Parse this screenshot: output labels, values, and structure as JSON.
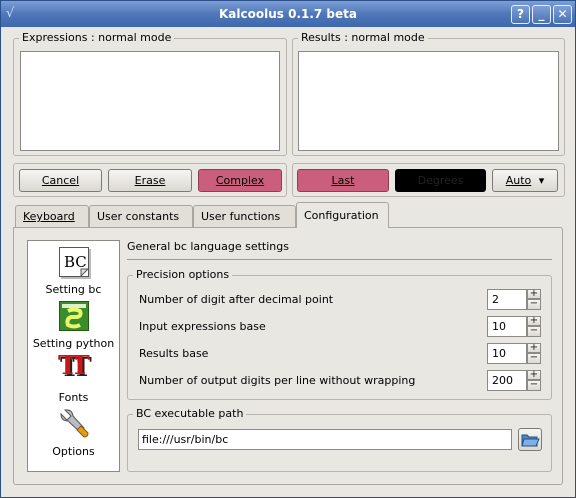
{
  "window": {
    "title": "Kalcoolus 0.1.7 beta",
    "app_icon_glyph": "√",
    "help_glyph": "?",
    "minimize_glyph": "_",
    "close_glyph": "✕"
  },
  "expressions": {
    "title": "Expressions : normal mode"
  },
  "results": {
    "title": "Results : normal mode"
  },
  "left_buttons": {
    "cancel": "Cancel",
    "erase": "Erase",
    "complex": "Complex"
  },
  "right_buttons": {
    "last": "Last",
    "dark_button": "Degrees",
    "auto": "Auto",
    "auto_arrow": "▾"
  },
  "tabs": [
    {
      "label": "Keyboard"
    },
    {
      "label": "User constants"
    },
    {
      "label": "User functions"
    },
    {
      "label": "Configuration"
    }
  ],
  "sidebar": {
    "items": [
      {
        "label": "Setting bc",
        "icon_text": "BC"
      },
      {
        "label": "Setting python"
      },
      {
        "label": "Fonts",
        "icon_text": "TT"
      },
      {
        "label": "Options"
      }
    ]
  },
  "config": {
    "heading": "General bc language settings",
    "precision_title": "Precision options",
    "rows": [
      {
        "label": "Number of digit after decimal point",
        "value": "2"
      },
      {
        "label": "Input expressions base",
        "value": "10"
      },
      {
        "label": "Results base",
        "value": "10"
      },
      {
        "label": "Number of output digits per line without wrapping",
        "value": "200"
      }
    ],
    "path_title": "BC executable path",
    "path_value": "file:///usr/bin/bc"
  },
  "colors": {
    "titlebar": "#4f77b9",
    "pink": "#cc5e7d"
  }
}
